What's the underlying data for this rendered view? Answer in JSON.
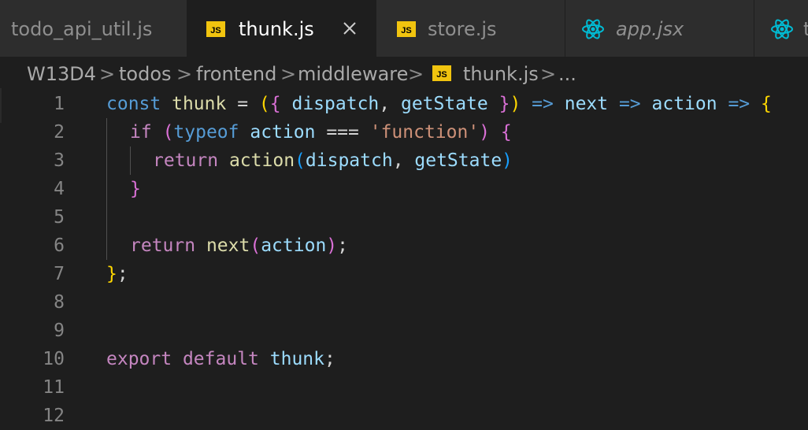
{
  "tabs": [
    {
      "label": "todo_api_util.js",
      "icon": null,
      "active": false
    },
    {
      "label": "thunk.js",
      "icon": "js-file-icon",
      "active": true
    },
    {
      "label": "store.js",
      "icon": "js-file-icon",
      "active": false
    },
    {
      "label": "app.jsx",
      "icon": "react-file-icon",
      "active": false
    },
    {
      "label": "t",
      "icon": "react-file-icon",
      "active": false
    }
  ],
  "js_icon_text": "JS",
  "breadcrumb": [
    "W13D4",
    "todos",
    "frontend",
    "middleware",
    "thunk.js",
    "..."
  ],
  "breadcrumb_separator": ">",
  "line_numbers": [
    "1",
    "2",
    "3",
    "4",
    "5",
    "6",
    "7",
    "8",
    "9",
    "10",
    "11",
    "12"
  ],
  "code": {
    "l1": {
      "const": "const",
      "thunk": "thunk",
      "eq": " = ",
      "p1": "(",
      "b1": "{",
      "sp1": " ",
      "dispatch": "dispatch",
      "comma": ", ",
      "getState": "getState",
      "sp2": " ",
      "b1c": "}",
      "p1c": ")",
      "arrow1": " => ",
      "next": "next",
      "arrow2": " => ",
      "action": "action",
      "arrow3": " => ",
      "b0": "{"
    },
    "l2": {
      "if": "if",
      "sp": " ",
      "p": "(",
      "typeof": "typeof",
      "sp2": " ",
      "action": "action",
      "op": " === ",
      "str": "'function'",
      "pc": ")",
      "sp3": " ",
      "b": "{"
    },
    "l3": {
      "return": "return",
      "sp": " ",
      "action": "action",
      "p": "(",
      "dispatch": "dispatch",
      "comma": ", ",
      "getState": "getState",
      "pc": ")"
    },
    "l4": {
      "b": "}"
    },
    "l6": {
      "return": "return",
      "sp": " ",
      "next": "next",
      "p": "(",
      "action": "action",
      "pc": ")",
      "semi": ";"
    },
    "l7": {
      "b": "}",
      "semi": ";"
    },
    "l10": {
      "export": "export",
      "sp": " ",
      "default": "default",
      "sp2": " ",
      "thunk": "thunk",
      "semi": ";"
    }
  },
  "colors": {
    "background": "#1e1e1e",
    "keyword_control": "#c586c0",
    "keyword_declaration": "#569cd6",
    "function": "#dcdcaa",
    "variable": "#9cdcfe",
    "string": "#ce9178",
    "bracket_gold": "#ffd700",
    "bracket_orchid": "#da70d6",
    "bracket_blue": "#179fff",
    "js_badge": "#f1c40f",
    "react_icon": "#00bcd4"
  }
}
